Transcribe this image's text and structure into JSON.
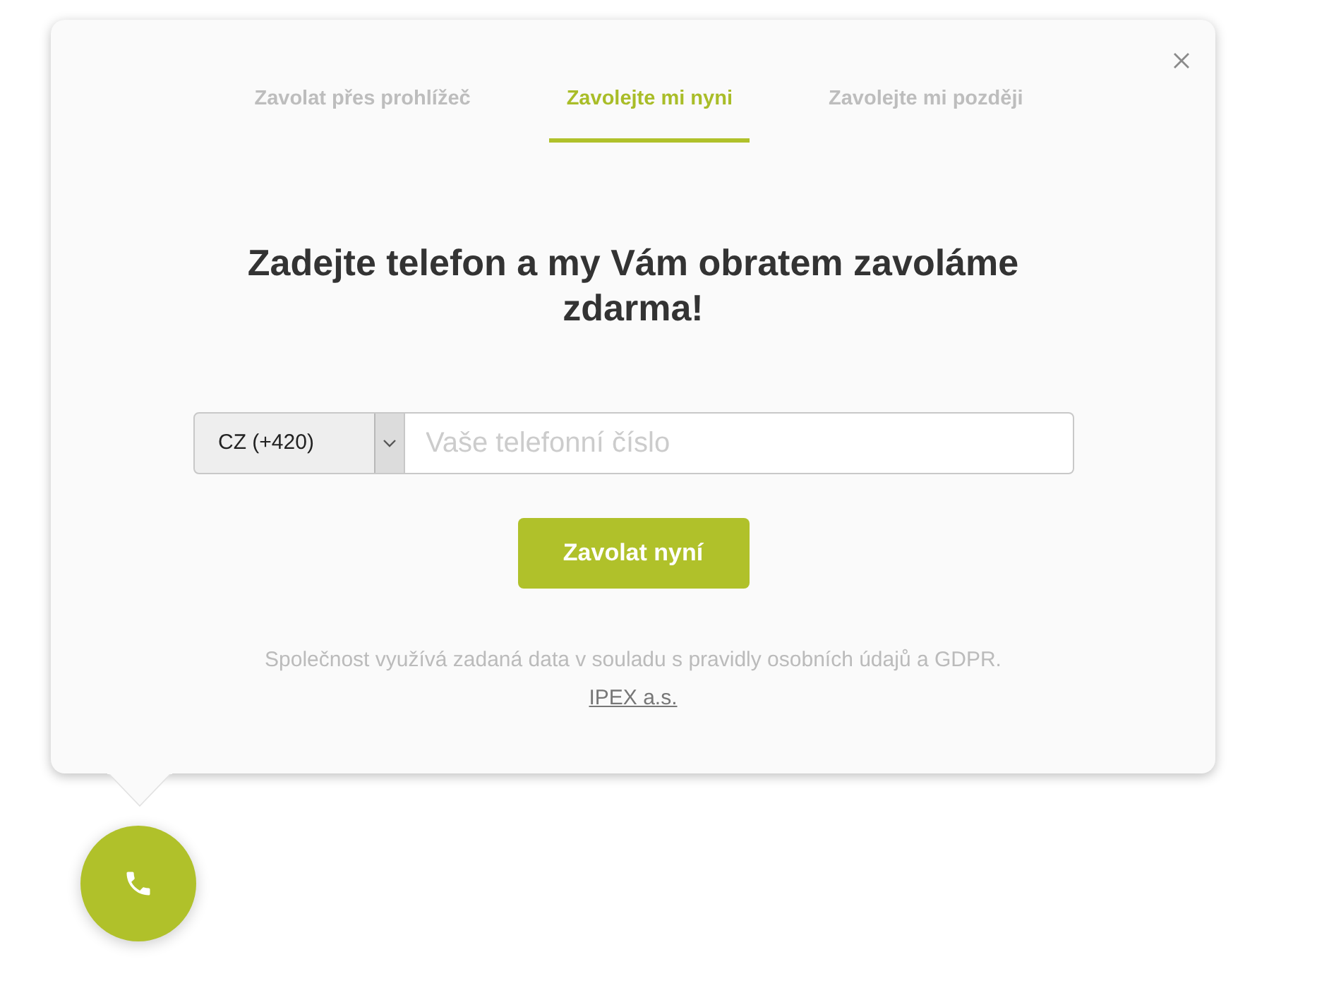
{
  "tabs": [
    {
      "label": "Zavolat přes prohlížeč",
      "selected": false
    },
    {
      "label": "Zavolejte mi nyni",
      "selected": true
    },
    {
      "label": "Zavolejte mi později",
      "selected": false
    }
  ],
  "heading": "Zadejte telefon a my Vám obratem zavoláme zdarma!",
  "phone_form": {
    "country": "CZ (+420)",
    "placeholder": "Vaše telefonní číslo"
  },
  "submit_button": "Zavolat nyní",
  "disclaimer": "Společnost využívá zadaná data v souladu s pravidly osobních údajů a GDPR.",
  "company_link": "IPEX a.s."
}
